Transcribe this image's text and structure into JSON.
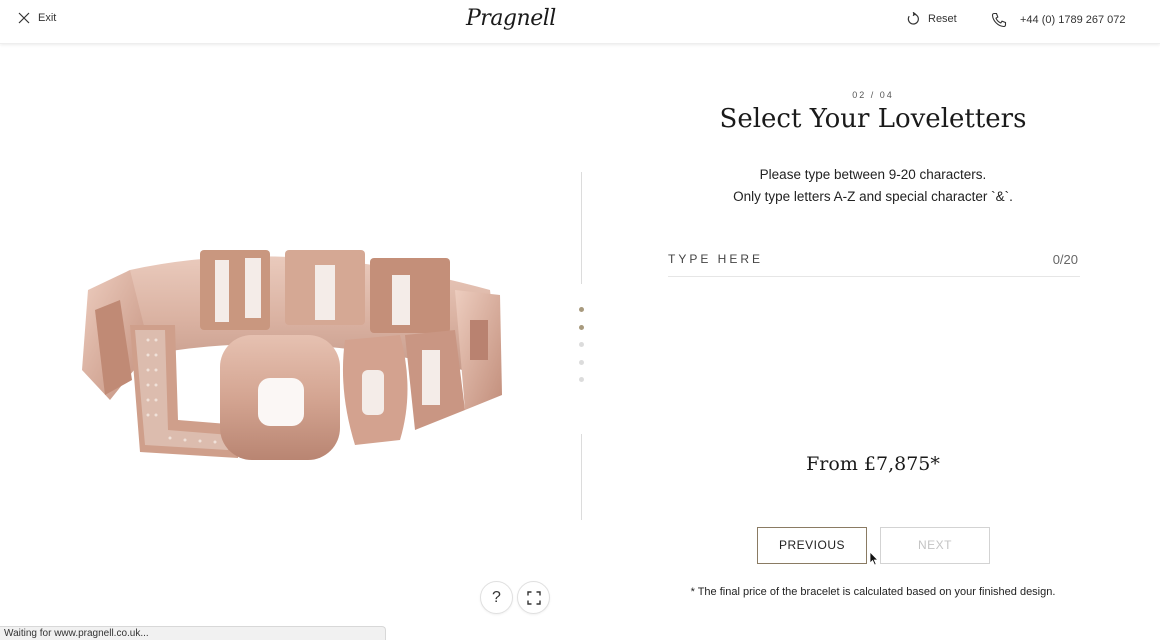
{
  "header": {
    "exit_label": "Exit",
    "logo_text": "Pragnell",
    "reset_label": "Reset",
    "phone": "+44 (0) 1789 267 072"
  },
  "step": {
    "indicator": "02 / 04",
    "title": "Select Your Loveletters",
    "instruction_line1": "Please type between 9-20 characters.",
    "instruction_line2": "Only type letters A-Z and special character `&`."
  },
  "input": {
    "label": "TYPE HERE",
    "value": "",
    "counter": "0/20"
  },
  "price": "From £7,875*",
  "buttons": {
    "previous": "PREVIOUS",
    "next": "NEXT"
  },
  "note": "* The final price of the bracelet is calculated based on your finished design.",
  "controls": {
    "help_glyph": "?"
  },
  "progress": {
    "current_step": 2,
    "total_steps": 5,
    "active_color": "#a89a7e",
    "inactive_color": "#dcdcdc"
  },
  "colors": {
    "accent": "#8a7b63",
    "rose_gold": "#d8ab99"
  },
  "statusbar": "Waiting for www.pragnell.co.uk..."
}
